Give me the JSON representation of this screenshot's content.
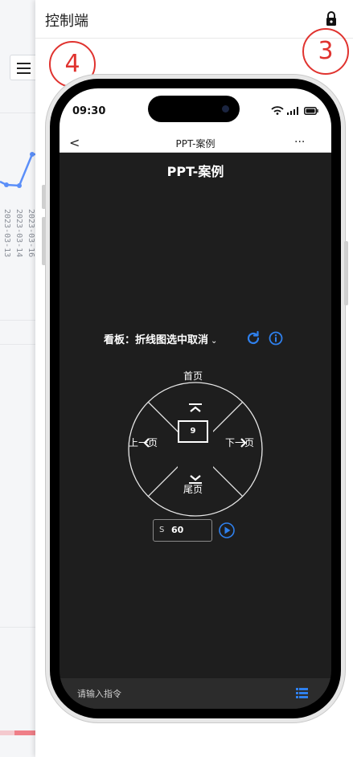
{
  "background": {
    "tick_labels": [
      "2023-03-13",
      "2023-03-14",
      "2023-03-16"
    ]
  },
  "panel": {
    "title": "控制端",
    "lock_icon": "lock-icon"
  },
  "annotations": {
    "left": "4",
    "right": "3"
  },
  "phone": {
    "status": {
      "time": "09:30"
    },
    "nav": {
      "back": "<",
      "title": "PPT-案例",
      "more": "···"
    },
    "app_title": "PPT-案例",
    "board": {
      "label": "看板：",
      "value": "折线图选中取消",
      "refresh_icon": "refresh-icon",
      "info_icon": "info-icon"
    },
    "wheel": {
      "top": "首页",
      "left": "上一页",
      "right": "下一页",
      "bottom": "尾页",
      "current_page": "9"
    },
    "seconds": {
      "prefix": "S",
      "value": "60"
    },
    "command": {
      "placeholder": "请输入指令"
    }
  },
  "colors": {
    "accent": "#2f80ed",
    "annotation": "#e0332f",
    "screen_bg": "#1e1e1e"
  }
}
